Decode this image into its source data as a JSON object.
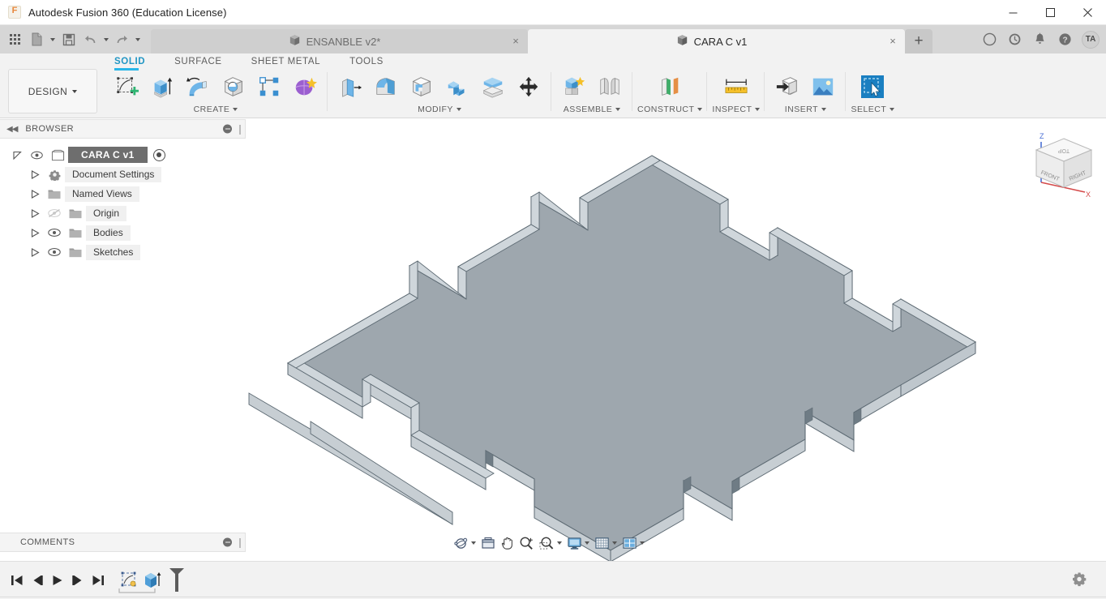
{
  "window": {
    "app_title": "Autodesk Fusion 360 (Education License)",
    "logo_letter": "F",
    "minimize_label": "Minimize",
    "maximize_label": "Maximize",
    "close_label": "Close"
  },
  "quick_access": {
    "grid_label": "Show Data Panel",
    "new_label": "New",
    "save_label": "Save",
    "undo_label": "Undo",
    "redo_label": "Redo"
  },
  "tabs": [
    {
      "label": "ENSANBLE v2*",
      "active": false,
      "close": "×"
    },
    {
      "label": "CARA  C v1",
      "active": true,
      "close": "×"
    }
  ],
  "tab_new_label": "+",
  "account": {
    "extension_label": "Extensions",
    "job_status_label": "Job Status",
    "notifications_label": "Notifications",
    "help_label": "Help",
    "initials": "TA"
  },
  "ribbon": {
    "workspace": "DESIGN",
    "tabs": [
      {
        "label": "SOLID",
        "active": true
      },
      {
        "label": "SURFACE",
        "active": false
      },
      {
        "label": "SHEET METAL",
        "active": false
      },
      {
        "label": "TOOLS",
        "active": false
      }
    ],
    "groups": [
      {
        "label": "CREATE",
        "has_caret": true,
        "tools": [
          {
            "name": "create-sketch-icon",
            "label": "Create Sketch",
            "selected": true
          },
          {
            "name": "extrude-icon",
            "label": "Extrude",
            "selected": false
          },
          {
            "name": "revolve-icon",
            "label": "Revolve",
            "selected": false
          },
          {
            "name": "sphere-icon",
            "label": "Sphere",
            "selected": false
          },
          {
            "name": "pattern-icon",
            "label": "Pattern",
            "selected": false
          },
          {
            "name": "form-icon",
            "label": "Create Form",
            "selected": false
          }
        ]
      },
      {
        "label": "MODIFY",
        "has_caret": true,
        "tools": [
          {
            "name": "press-pull-icon",
            "label": "Press Pull",
            "selected": false
          },
          {
            "name": "fillet-icon",
            "label": "Fillet",
            "selected": false
          },
          {
            "name": "shell-icon",
            "label": "Shell",
            "selected": false
          },
          {
            "name": "combine-icon",
            "label": "Combine",
            "selected": false
          },
          {
            "name": "split-body-icon",
            "label": "Split Body",
            "selected": false
          },
          {
            "name": "move-copy-icon",
            "label": "Move/Copy",
            "selected": false
          }
        ]
      },
      {
        "label": "ASSEMBLE",
        "has_caret": true,
        "tools": [
          {
            "name": "new-component-icon",
            "label": "New Component",
            "selected": false
          },
          {
            "name": "joint-icon",
            "label": "Joint",
            "selected": false
          }
        ]
      },
      {
        "label": "CONSTRUCT",
        "has_caret": true,
        "tools": [
          {
            "name": "offset-plane-icon",
            "label": "Offset Plane",
            "selected": false
          }
        ]
      },
      {
        "label": "INSPECT",
        "has_caret": true,
        "tools": [
          {
            "name": "measure-icon",
            "label": "Measure",
            "selected": false
          }
        ]
      },
      {
        "label": "INSERT",
        "has_caret": true,
        "tools": [
          {
            "name": "insert-derive-icon",
            "label": "Insert Derive",
            "selected": false
          },
          {
            "name": "canvas-image-icon",
            "label": "Canvas",
            "selected": false
          }
        ]
      },
      {
        "label": "SELECT",
        "has_caret": true,
        "tools": [
          {
            "name": "select-icon",
            "label": "Select",
            "selected": false
          }
        ]
      }
    ]
  },
  "browser": {
    "title": "BROWSER",
    "collapse_label": "◀◀",
    "tree": [
      {
        "label": "CARA  C v1",
        "level": 0,
        "expanded": true,
        "eye": true,
        "icon": "component-icon",
        "activate_radio": true
      },
      {
        "label": "Document Settings",
        "level": 1,
        "expanded": false,
        "eye": false,
        "icon": "gear-icon"
      },
      {
        "label": "Named Views",
        "level": 1,
        "expanded": false,
        "eye": false,
        "icon": "folder-icon"
      },
      {
        "label": "Origin",
        "level": 1,
        "expanded": false,
        "eye": "off",
        "icon": "folder-icon"
      },
      {
        "label": "Bodies",
        "level": 1,
        "expanded": false,
        "eye": true,
        "icon": "folder-icon"
      },
      {
        "label": "Sketches",
        "level": 1,
        "expanded": false,
        "eye": true,
        "icon": "folder-icon"
      }
    ]
  },
  "comments": {
    "title": "COMMENTS",
    "add_label": "+"
  },
  "viewcube": {
    "top_face": "TOP",
    "front_face": "FRONT",
    "right_face": "RIGHT",
    "axis_z": "Z",
    "axis_x": "X"
  },
  "navbar": [
    {
      "name": "orbit-icon",
      "label": "Orbit",
      "caret": true
    },
    {
      "name": "look-at-icon",
      "label": "Look At",
      "caret": false
    },
    {
      "name": "pan-icon",
      "label": "Pan",
      "caret": false
    },
    {
      "name": "zoom-icon",
      "label": "Zoom",
      "caret": false
    },
    {
      "name": "zoom-window-icon",
      "label": "Fit",
      "caret": true
    },
    {
      "name": "display-settings-icon",
      "label": "Display Settings",
      "caret": true
    },
    {
      "name": "grid-snaps-icon",
      "label": "Grid and Snaps",
      "caret": true
    },
    {
      "name": "viewports-icon",
      "label": "Viewports",
      "caret": true
    }
  ],
  "timeline": {
    "buttons": [
      {
        "name": "go-to-beginning-icon",
        "label": "Go to beginning"
      },
      {
        "name": "step-back-icon",
        "label": "Step back"
      },
      {
        "name": "play-icon",
        "label": "Play"
      },
      {
        "name": "step-forward-icon",
        "label": "Step forward"
      },
      {
        "name": "go-to-end-icon",
        "label": "Go to end"
      }
    ],
    "features": [
      {
        "name": "sketch-feature-icon",
        "label": "Sketch1"
      },
      {
        "name": "extrude-feature-icon",
        "label": "Extrude1"
      }
    ],
    "settings_label": "Timeline Settings"
  },
  "model": {
    "name": "notched-plate-body",
    "face_top_color": "#9ea7ae",
    "face_side_color": "#c3ccd2",
    "edge_color": "#5d6a73"
  }
}
